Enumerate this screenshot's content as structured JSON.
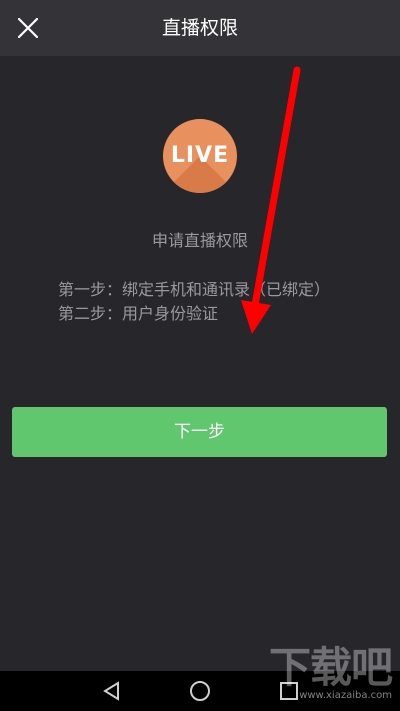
{
  "header": {
    "title": "直播权限",
    "close_icon": "close-icon"
  },
  "logo": {
    "text": "LIVE",
    "color": "#e8915f"
  },
  "main": {
    "apply_title": "申请直播权限",
    "steps": [
      "第一步：绑定手机和通讯录（已绑定）",
      "第二步：用户身份验证"
    ],
    "next_button": "下一步"
  },
  "annotation": {
    "arrow_color": "#ff0000"
  },
  "navbar": {
    "back_icon": "back-triangle-icon",
    "home_icon": "home-circle-icon",
    "recent_icon": "recent-square-icon"
  },
  "watermark": {
    "big": "下载吧",
    "small": "www.xiazaiba.com"
  },
  "colors": {
    "background": "#26262b",
    "topbar": "#343438",
    "button": "#61c76f"
  }
}
